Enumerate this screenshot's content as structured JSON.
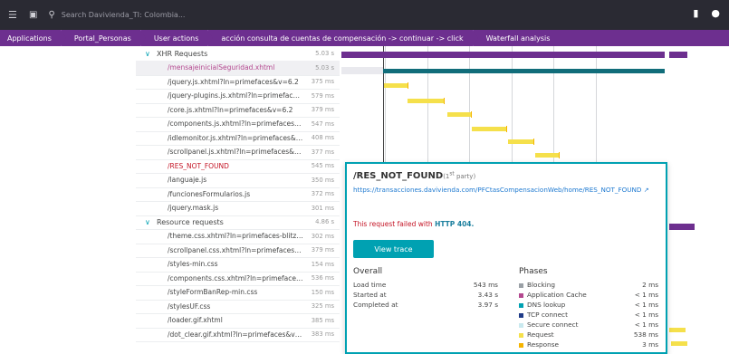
{
  "topbar": {
    "search_placeholder": "Search Davivienda_TI: Colombia..."
  },
  "breadcrumb": [
    "Applications",
    "Portal_Personas",
    "User actions",
    "acción consulta de cuentas de compensación -> continuar -> click",
    "Waterfall analysis"
  ],
  "rows": [
    {
      "name": "XHR Requests",
      "value": "5.03 s",
      "group": true
    },
    {
      "name": "/mensajeinicialSeguridad.xhtml",
      "value": "5.03 s",
      "hl": true
    },
    {
      "name": "/jquery.js.xhtml?ln=primefaces&v=6.2",
      "value": "375 ms"
    },
    {
      "name": "/jquery-plugins.js.xhtml?ln=primefaces&...",
      "value": "579 ms"
    },
    {
      "name": "/core.js.xhtml?ln=primefaces&v=6.2",
      "value": "379 ms"
    },
    {
      "name": "/components.js.xhtml?ln=primefaces&v=...",
      "value": "547 ms"
    },
    {
      "name": "/idlemonitor.js.xhtml?ln=primefaces&v=...",
      "value": "408 ms"
    },
    {
      "name": "/scrollpanel.js.xhtml?ln=primefaces&v=6.2",
      "value": "377 ms"
    },
    {
      "name": "/RES_NOT_FOUND",
      "value": "545 ms",
      "err": true
    },
    {
      "name": "/languaje.js",
      "value": "350 ms"
    },
    {
      "name": "/funcionesFormularios.js",
      "value": "372 ms"
    },
    {
      "name": "/jquery.mask.js",
      "value": "301 ms"
    },
    {
      "name": "Resource requests",
      "value": "4.86 s",
      "group": true
    },
    {
      "name": "/theme.css.xhtml?ln=primefaces-blitzer",
      "value": "302 ms"
    },
    {
      "name": "/scrollpanel.css.xhtml?ln=primefaces&v=...",
      "value": "379 ms"
    },
    {
      "name": "/styles-min.css",
      "value": "154 ms"
    },
    {
      "name": "/components.css.xhtml?ln=primefaces&v...",
      "value": "536 ms"
    },
    {
      "name": "/styleFormBanRep-min.css",
      "value": "150 ms"
    },
    {
      "name": "/stylesUF.css",
      "value": "325 ms"
    },
    {
      "name": "/loader.gif.xhtml",
      "value": "385 ms"
    },
    {
      "name": "/dot_clear.gif.xhtml?ln=primefaces&v=6.2",
      "value": "383 ms"
    }
  ],
  "tooltip": {
    "title": "/RES_NOT_FOUND",
    "party_num": "(1",
    "party_sup": "st",
    "party_text": " party)",
    "url": "https://transacciones.davivienda.com/PFCtasCompensacionWeb/home/RES_NOT_FOUND",
    "error_text": "This request failed with ",
    "error_code": "HTTP 404.",
    "button": "View trace",
    "overall_title": "Overall",
    "overall": [
      {
        "label": "Load time",
        "value": "543 ms"
      },
      {
        "label": "Started at",
        "value": "3.43 s"
      },
      {
        "label": "Completed at",
        "value": "3.97 s"
      }
    ],
    "phases_title": "Phases",
    "phases": [
      {
        "label": "Blocking",
        "value": "2 ms",
        "color": "#9aa0a6"
      },
      {
        "label": "Application Cache",
        "value": "< 1 ms",
        "color": "#b4488f"
      },
      {
        "label": "DNS lookup",
        "value": "< 1 ms",
        "color": "#00a1b2"
      },
      {
        "label": "TCP connect",
        "value": "< 1 ms",
        "color": "#1f3c88"
      },
      {
        "label": "Secure connect",
        "value": "< 1 ms",
        "color": "#c9e9ef"
      },
      {
        "label": "Request",
        "value": "538 ms",
        "color": "#f5e04b"
      },
      {
        "label": "Response",
        "value": "3 ms",
        "color": "#f5b400"
      }
    ]
  },
  "colors": {
    "accent": "#00a1b2",
    "purple": "#6d2f8f",
    "teal": "#116d7a",
    "bar": "#f5e04b"
  }
}
